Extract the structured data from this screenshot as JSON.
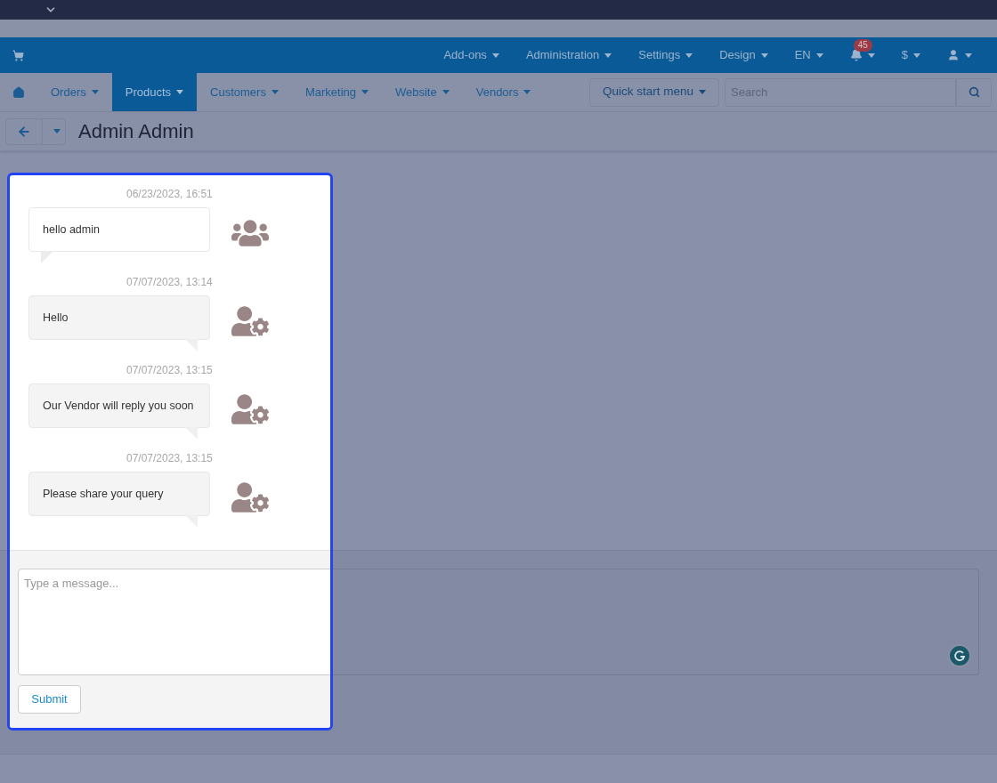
{
  "top_bar": {
    "menu": [
      {
        "label": "Add-ons"
      },
      {
        "label": "Administration"
      },
      {
        "label": "Settings"
      },
      {
        "label": "Design"
      },
      {
        "label": "EN"
      }
    ],
    "notifications": {
      "count": "45"
    },
    "currency": {
      "label": "$"
    }
  },
  "nav": {
    "items": [
      {
        "label": "Orders",
        "selected": false
      },
      {
        "label": "Products",
        "selected": true
      },
      {
        "label": "Customers",
        "selected": false
      },
      {
        "label": "Marketing",
        "selected": false
      },
      {
        "label": "Website",
        "selected": false
      },
      {
        "label": "Vendors",
        "selected": false
      }
    ],
    "quick_start": "Quick start menu",
    "search": {
      "placeholder": "Search"
    }
  },
  "page": {
    "title": "Admin Admin"
  },
  "chat": {
    "messages": [
      {
        "timestamp": "06/23/2023, 16:51",
        "text": "hello admin",
        "kind": "received"
      },
      {
        "timestamp": "07/07/2023, 13:14",
        "text": "Hello",
        "kind": "sent"
      },
      {
        "timestamp": "07/07/2023, 13:15",
        "text": "Our Vendor will reply you soon",
        "kind": "sent"
      },
      {
        "timestamp": "07/07/2023, 13:15",
        "text": "Please share your query",
        "kind": "sent"
      }
    ],
    "composer": {
      "placeholder": "Type a message..."
    },
    "submit": "Submit"
  }
}
